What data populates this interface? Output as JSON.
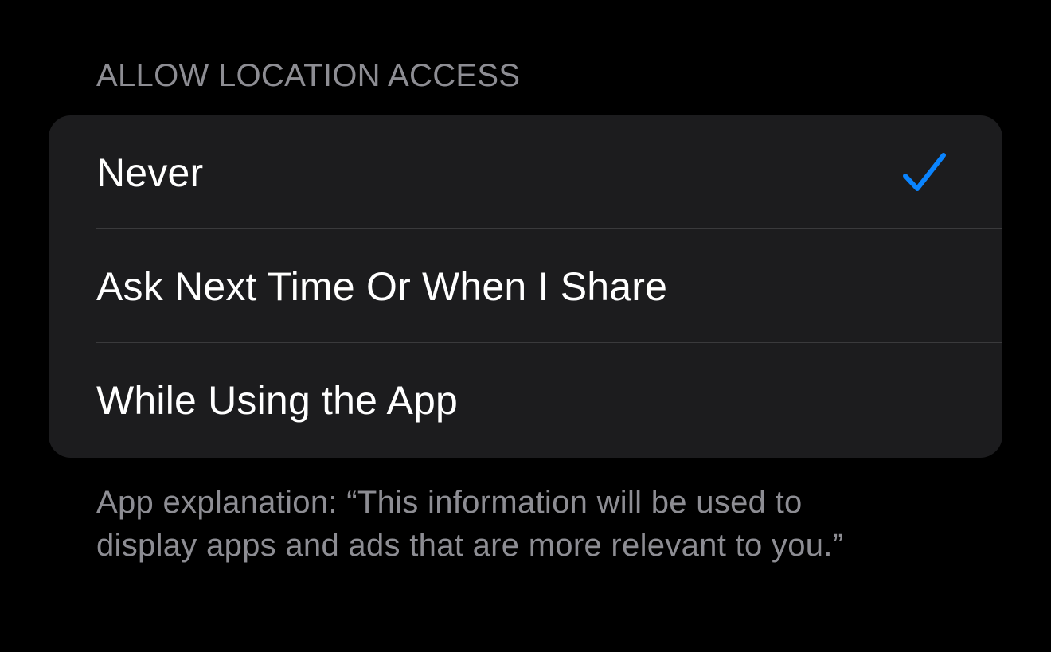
{
  "section": {
    "header": "ALLOW LOCATION ACCESS"
  },
  "options": [
    {
      "label": "Never",
      "selected": true
    },
    {
      "label": "Ask Next Time Or When I Share",
      "selected": false
    },
    {
      "label": "While Using the App",
      "selected": false
    }
  ],
  "footer": {
    "line1": "App explanation: “This information will be used to",
    "line2": "display apps and ads that are more relevant to you.”"
  },
  "icons": {
    "selected": "checkmark-icon"
  },
  "colors": {
    "background": "#000000",
    "group_background": "#1c1c1e",
    "separator": "#3a3a3c",
    "primary_text": "#ffffff",
    "secondary_text": "#8d8d93",
    "accent": "#0a84ff"
  }
}
